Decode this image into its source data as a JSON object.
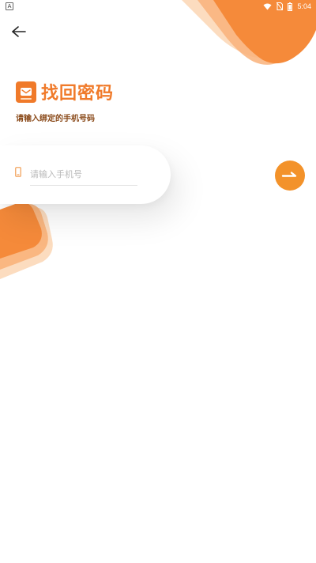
{
  "status_bar": {
    "left_icon_label": "A",
    "time": "5:04"
  },
  "page": {
    "title": "找回密码",
    "subtitle": "请输入绑定的手机号码"
  },
  "phone_input": {
    "placeholder": "请输入手机号",
    "value": ""
  },
  "icons": {
    "back": "back-arrow-icon",
    "logo": "app-logo-icon",
    "phone": "phone-icon",
    "next": "arrow-right-icon"
  },
  "colors": {
    "accent": "#f07a2a",
    "accent_light": "#fbc79a",
    "subtitle": "#8a4a1a",
    "placeholder": "#b9b9b9"
  }
}
